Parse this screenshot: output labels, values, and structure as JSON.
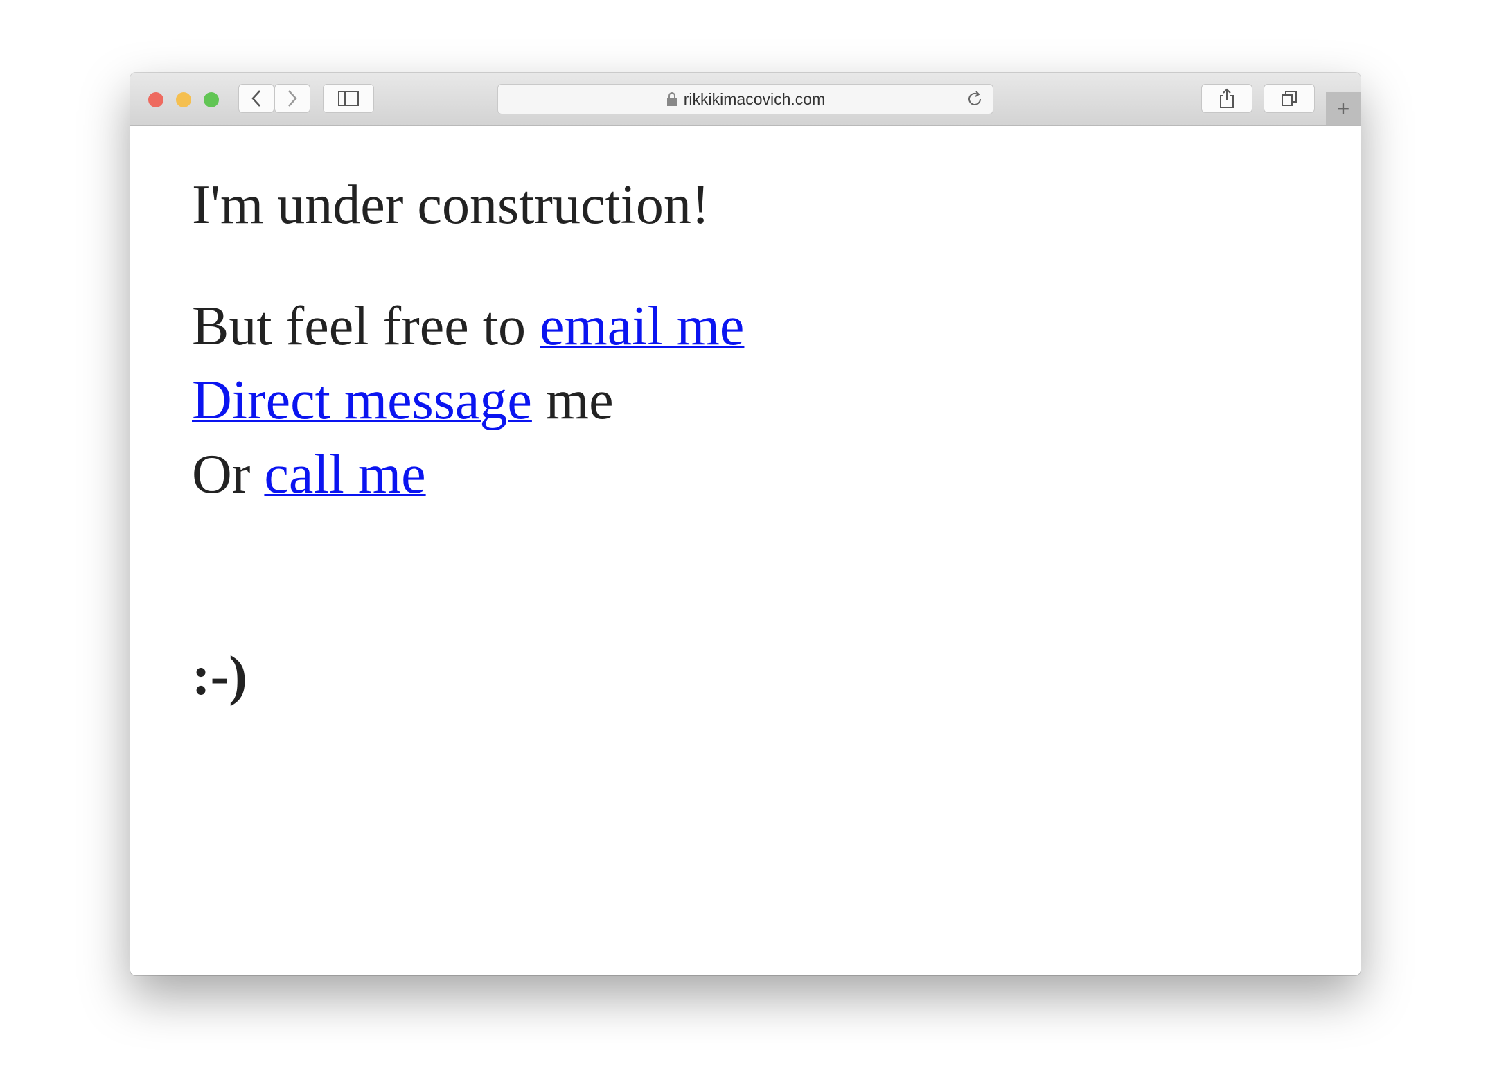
{
  "browser": {
    "url": "rikkikimacovich.com",
    "icons": [
      "close-light",
      "minimize-light",
      "zoom-light",
      "back-icon",
      "forward-icon",
      "sidebar-icon",
      "lock-icon",
      "reload-icon",
      "share-icon",
      "tabs-icon",
      "new-tab-icon"
    ],
    "traffic_colors": {
      "close": "#ee6a5f",
      "minimize": "#f5bf4f",
      "zoom": "#61c554"
    }
  },
  "page": {
    "heading": "I'm under construction!",
    "line1_text": "But feel free to ",
    "line1_link": "email me",
    "line2_link": "Direct message",
    "line2_text": " me",
    "line3_text": "Or ",
    "line3_link": "call me",
    "smiley": ":-)",
    "link_color": "#0a14f0"
  }
}
